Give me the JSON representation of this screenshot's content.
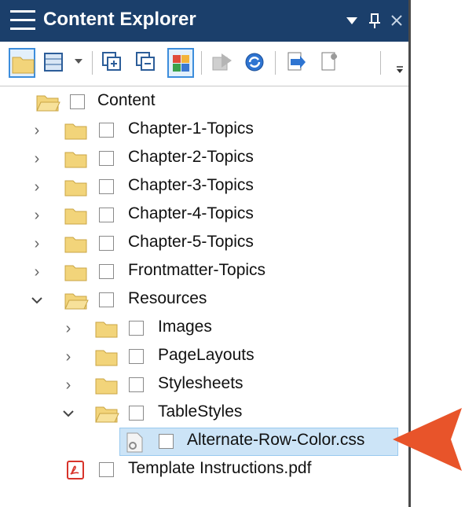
{
  "window": {
    "title": "Content Explorer",
    "menu_arrow_icon": "dropdown-arrow-icon",
    "pin_icon": "pin-icon",
    "close_icon": "close-icon"
  },
  "toolbar": {
    "buttons": [
      "folder-icon",
      "view-grid-icon",
      "expand-all-icon",
      "collapse-all-icon",
      "color-grid-icon",
      "send-icon",
      "refresh-icon",
      "publish-icon",
      "properties-icon",
      "overflow-icon"
    ]
  },
  "tree": {
    "root": "Content",
    "items": [
      {
        "label": "Chapter-1-Topics"
      },
      {
        "label": "Chapter-2-Topics"
      },
      {
        "label": "Chapter-3-Topics"
      },
      {
        "label": "Chapter-4-Topics"
      },
      {
        "label": "Chapter-5-Topics"
      },
      {
        "label": "Frontmatter-Topics"
      },
      {
        "label": "Resources"
      },
      {
        "label": "Images"
      },
      {
        "label": "PageLayouts"
      },
      {
        "label": "Stylesheets"
      },
      {
        "label": "TableStyles"
      },
      {
        "label": "Alternate-Row-Color.css"
      },
      {
        "label": "Template Instructions.pdf"
      }
    ]
  },
  "colors": {
    "titlebar": "#1b3f6b",
    "folder": "#f2d47a",
    "selection": "#cce4f7",
    "callout": "#e8542a"
  }
}
